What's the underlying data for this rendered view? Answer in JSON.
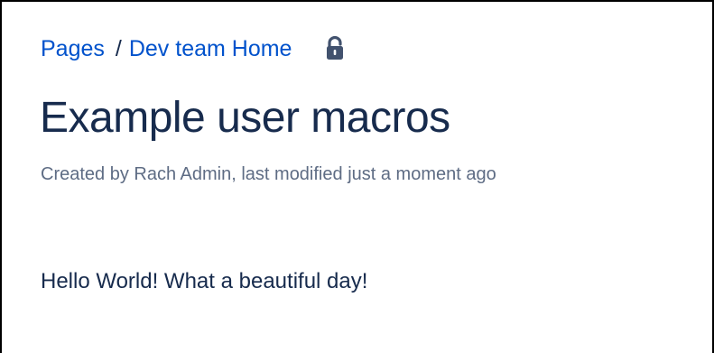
{
  "breadcrumb": {
    "items": [
      {
        "label": "Pages"
      },
      {
        "label": "Dev team Home"
      }
    ],
    "separator": "/",
    "restriction_icon": "unlocked-padlock-icon"
  },
  "page": {
    "title": "Example user macros",
    "byline": {
      "prefix": "Created by ",
      "author": "Rach Admin",
      "middle": ", last modified ",
      "modified": "just a moment ago"
    },
    "body_text": "Hello World! What a beautiful day!"
  },
  "colors": {
    "link": "#0052cc",
    "heading": "#172b4d",
    "meta": "#5e6c84",
    "text": "#172b4d"
  }
}
